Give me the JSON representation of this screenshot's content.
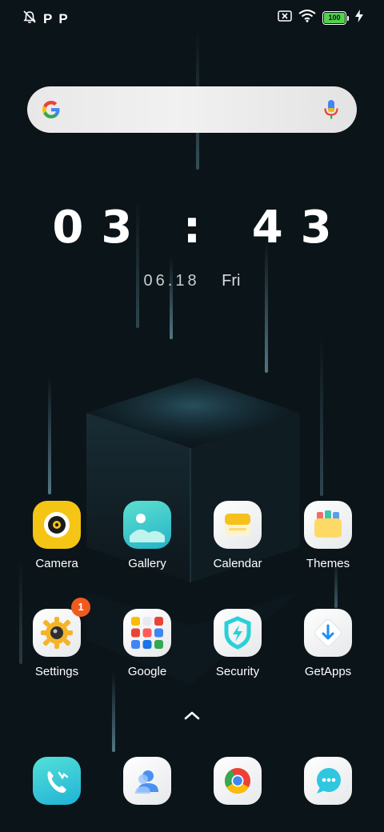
{
  "status_bar": {
    "left_icons": [
      "alarm-off-icon",
      "parking-icon",
      "parking-icon"
    ],
    "left_text": [
      "P",
      "P"
    ],
    "right_icons": [
      "sim-x-icon",
      "wifi-icon",
      "battery-icon",
      "charging-icon"
    ],
    "battery_level": "100",
    "battery_color": "#53d14b"
  },
  "search_bar": {
    "icon_left": "google-icon",
    "icon_right": "microphone-icon"
  },
  "clock": {
    "time": "03 : 43",
    "date": "06.18",
    "day": "Fri"
  },
  "apps_row1": [
    {
      "label": "Camera",
      "icon": "camera-icon"
    },
    {
      "label": "Gallery",
      "icon": "gallery-icon"
    },
    {
      "label": "Calendar",
      "icon": "calendar-icon"
    },
    {
      "label": "Themes",
      "icon": "themes-icon"
    }
  ],
  "apps_row2": [
    {
      "label": "Settings",
      "icon": "settings-icon",
      "badge": "1"
    },
    {
      "label": "Google",
      "icon": "google-folder-icon"
    },
    {
      "label": "Security",
      "icon": "security-icon"
    },
    {
      "label": "GetApps",
      "icon": "getapps-icon"
    }
  ],
  "dock": [
    {
      "icon": "phone-icon"
    },
    {
      "icon": "contacts-icon"
    },
    {
      "icon": "chrome-icon"
    },
    {
      "icon": "messages-icon"
    }
  ],
  "colors": {
    "background": "#0b1419",
    "badge": "#f05a1f",
    "accent_teal": "#2ad0d8"
  }
}
